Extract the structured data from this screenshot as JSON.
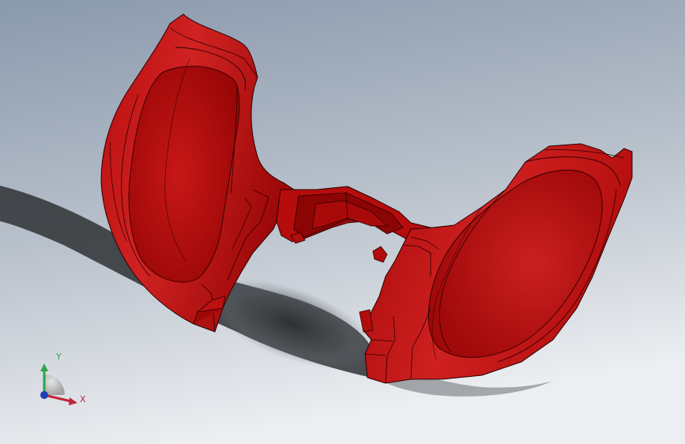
{
  "viewport": {
    "background_top": "#8e9db0",
    "background_bottom": "#e9ecef",
    "shadow_color": "#2e3033"
  },
  "model": {
    "color": "#c81414",
    "highlight_color": "#d83030",
    "shade_color": "#8a0606",
    "edge_color": "#2a0000"
  },
  "triad": {
    "x_label": "X",
    "y_label": "Y",
    "x_color": "#c0263a",
    "y_color": "#2ca54a",
    "z_color": "#1f3fb5"
  }
}
